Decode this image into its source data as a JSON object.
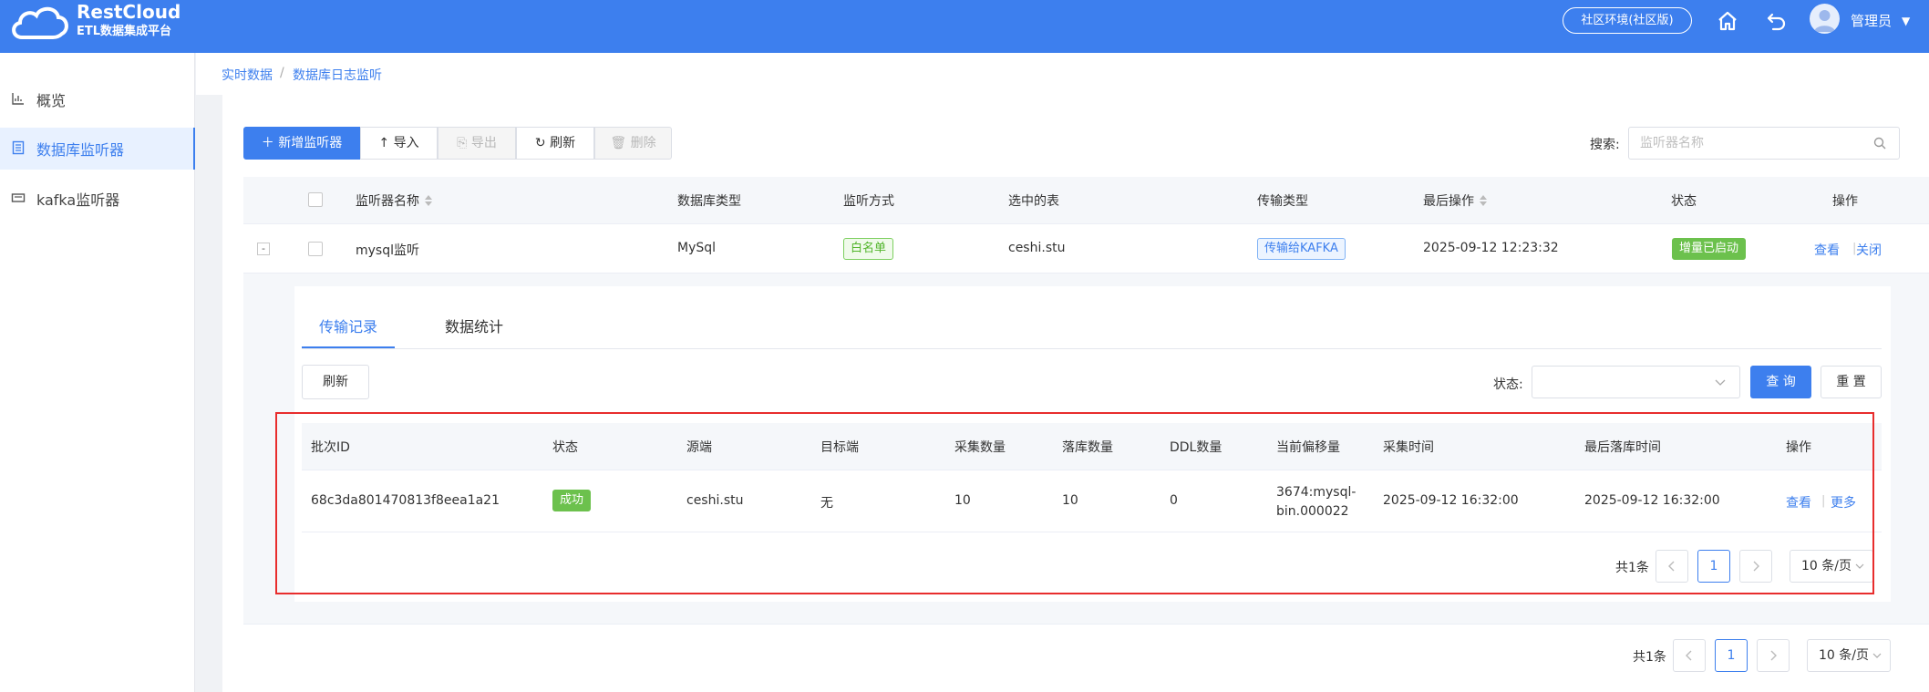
{
  "header": {
    "brand": "RestCloud",
    "brand_sub": "ETL数据集成平台",
    "env_badge": "社区环境(社区版)",
    "user_name": "管理员",
    "icons": [
      "home-icon",
      "back-icon",
      "avatar",
      "caret-down-icon"
    ]
  },
  "sidebar": {
    "items": [
      {
        "label": "概览",
        "icon": "chart-icon"
      },
      {
        "label": "数据库监听器",
        "icon": "list-icon"
      },
      {
        "label": "kafka监听器",
        "icon": "inbox-icon"
      }
    ]
  },
  "breadcrumb": [
    "实时数据",
    "数据库日志监听"
  ],
  "breadcrumb_sep": "/",
  "toolbar": {
    "add": "新增监听器",
    "import": "导入",
    "export": "导出",
    "refresh": "刷新",
    "delete": "删除",
    "search_label": "搜索:",
    "search_placeholder": "监听器名称"
  },
  "main_table": {
    "columns": [
      "监听器名称",
      "数据库类型",
      "监听方式",
      "选中的表",
      "传输类型",
      "最后操作",
      "状态",
      "操作"
    ],
    "expand_symbol": "-",
    "row": {
      "name": "mysql监听",
      "db_type": "MySql",
      "mode": "白名单",
      "table": "ceshi.stu",
      "transfer": "传输给KAFKA",
      "last_op": "2025-09-12 12:23:32",
      "status": "增量已启动",
      "action_view": "查看",
      "action_close": "关闭",
      "action_sep": "|"
    }
  },
  "detail": {
    "tabs": [
      "传输记录",
      "数据统计"
    ],
    "active_tab": 0,
    "refresh": "刷新",
    "status_label": "状态:",
    "query": "查 询",
    "reset": "重 置",
    "columns": [
      "批次ID",
      "状态",
      "源端",
      "目标端",
      "采集数量",
      "落库数量",
      "DDL数量",
      "当前偏移量",
      "采集时间",
      "最后落库时间",
      "操作"
    ],
    "row": {
      "batch_id": "68c3da801470813f8eea1a21",
      "status": "成功",
      "source": "ceshi.stu",
      "target": "无",
      "collected": "10",
      "stored": "10",
      "ddl": "0",
      "offset_line1": "3674:mysql-",
      "offset_line2": "bin.000022",
      "collect_time": "2025-09-12 16:32:00",
      "last_store_time": "2025-09-12 16:32:00",
      "action_view": "查看",
      "action_more": "更多",
      "action_sep": "|"
    },
    "pagination": {
      "total": "共1条",
      "page": "1",
      "size": "10 条/页"
    }
  },
  "pagination": {
    "total": "共1条",
    "page": "1",
    "size": "10 条/页"
  },
  "colors": {
    "primary": "#3d7fee",
    "success": "#6cc14d",
    "highlight": "#e82d2d"
  }
}
